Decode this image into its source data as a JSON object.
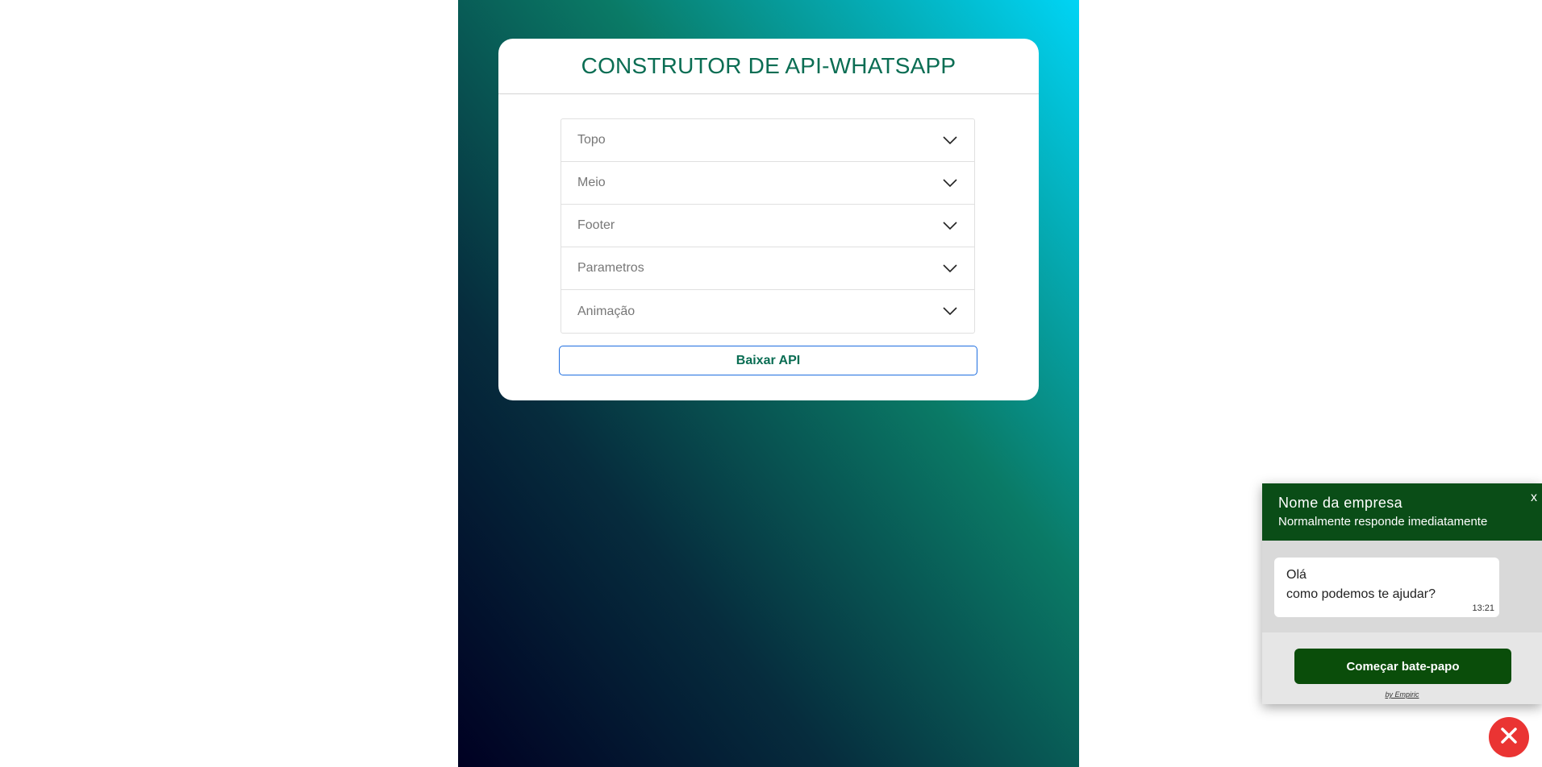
{
  "builder": {
    "title": "CONSTRUTOR DE API-WHATSAPP",
    "sections": [
      {
        "label": "Topo"
      },
      {
        "label": "Meio"
      },
      {
        "label": "Footer"
      },
      {
        "label": "Parametros"
      },
      {
        "label": "Animação"
      }
    ],
    "download_label": "Baixar API"
  },
  "chat_widget": {
    "company_name": "Nome da empresa",
    "status": "Normalmente responde imediatamente",
    "close_label": "x",
    "message_line1": "Olá",
    "message_line2": "como podemos te ajudar?",
    "message_time": "13:21",
    "start_button": "Começar bate-papo",
    "byline": "by Empiric"
  },
  "colors": {
    "brand_green": "#0a6d53",
    "chat_header": "#0a4d17",
    "close_fab": "#ea3433",
    "download_border": "#1e6ee0"
  },
  "icons": {
    "accordion_toggle": "chevron-down-icon",
    "fab": "close-icon"
  }
}
